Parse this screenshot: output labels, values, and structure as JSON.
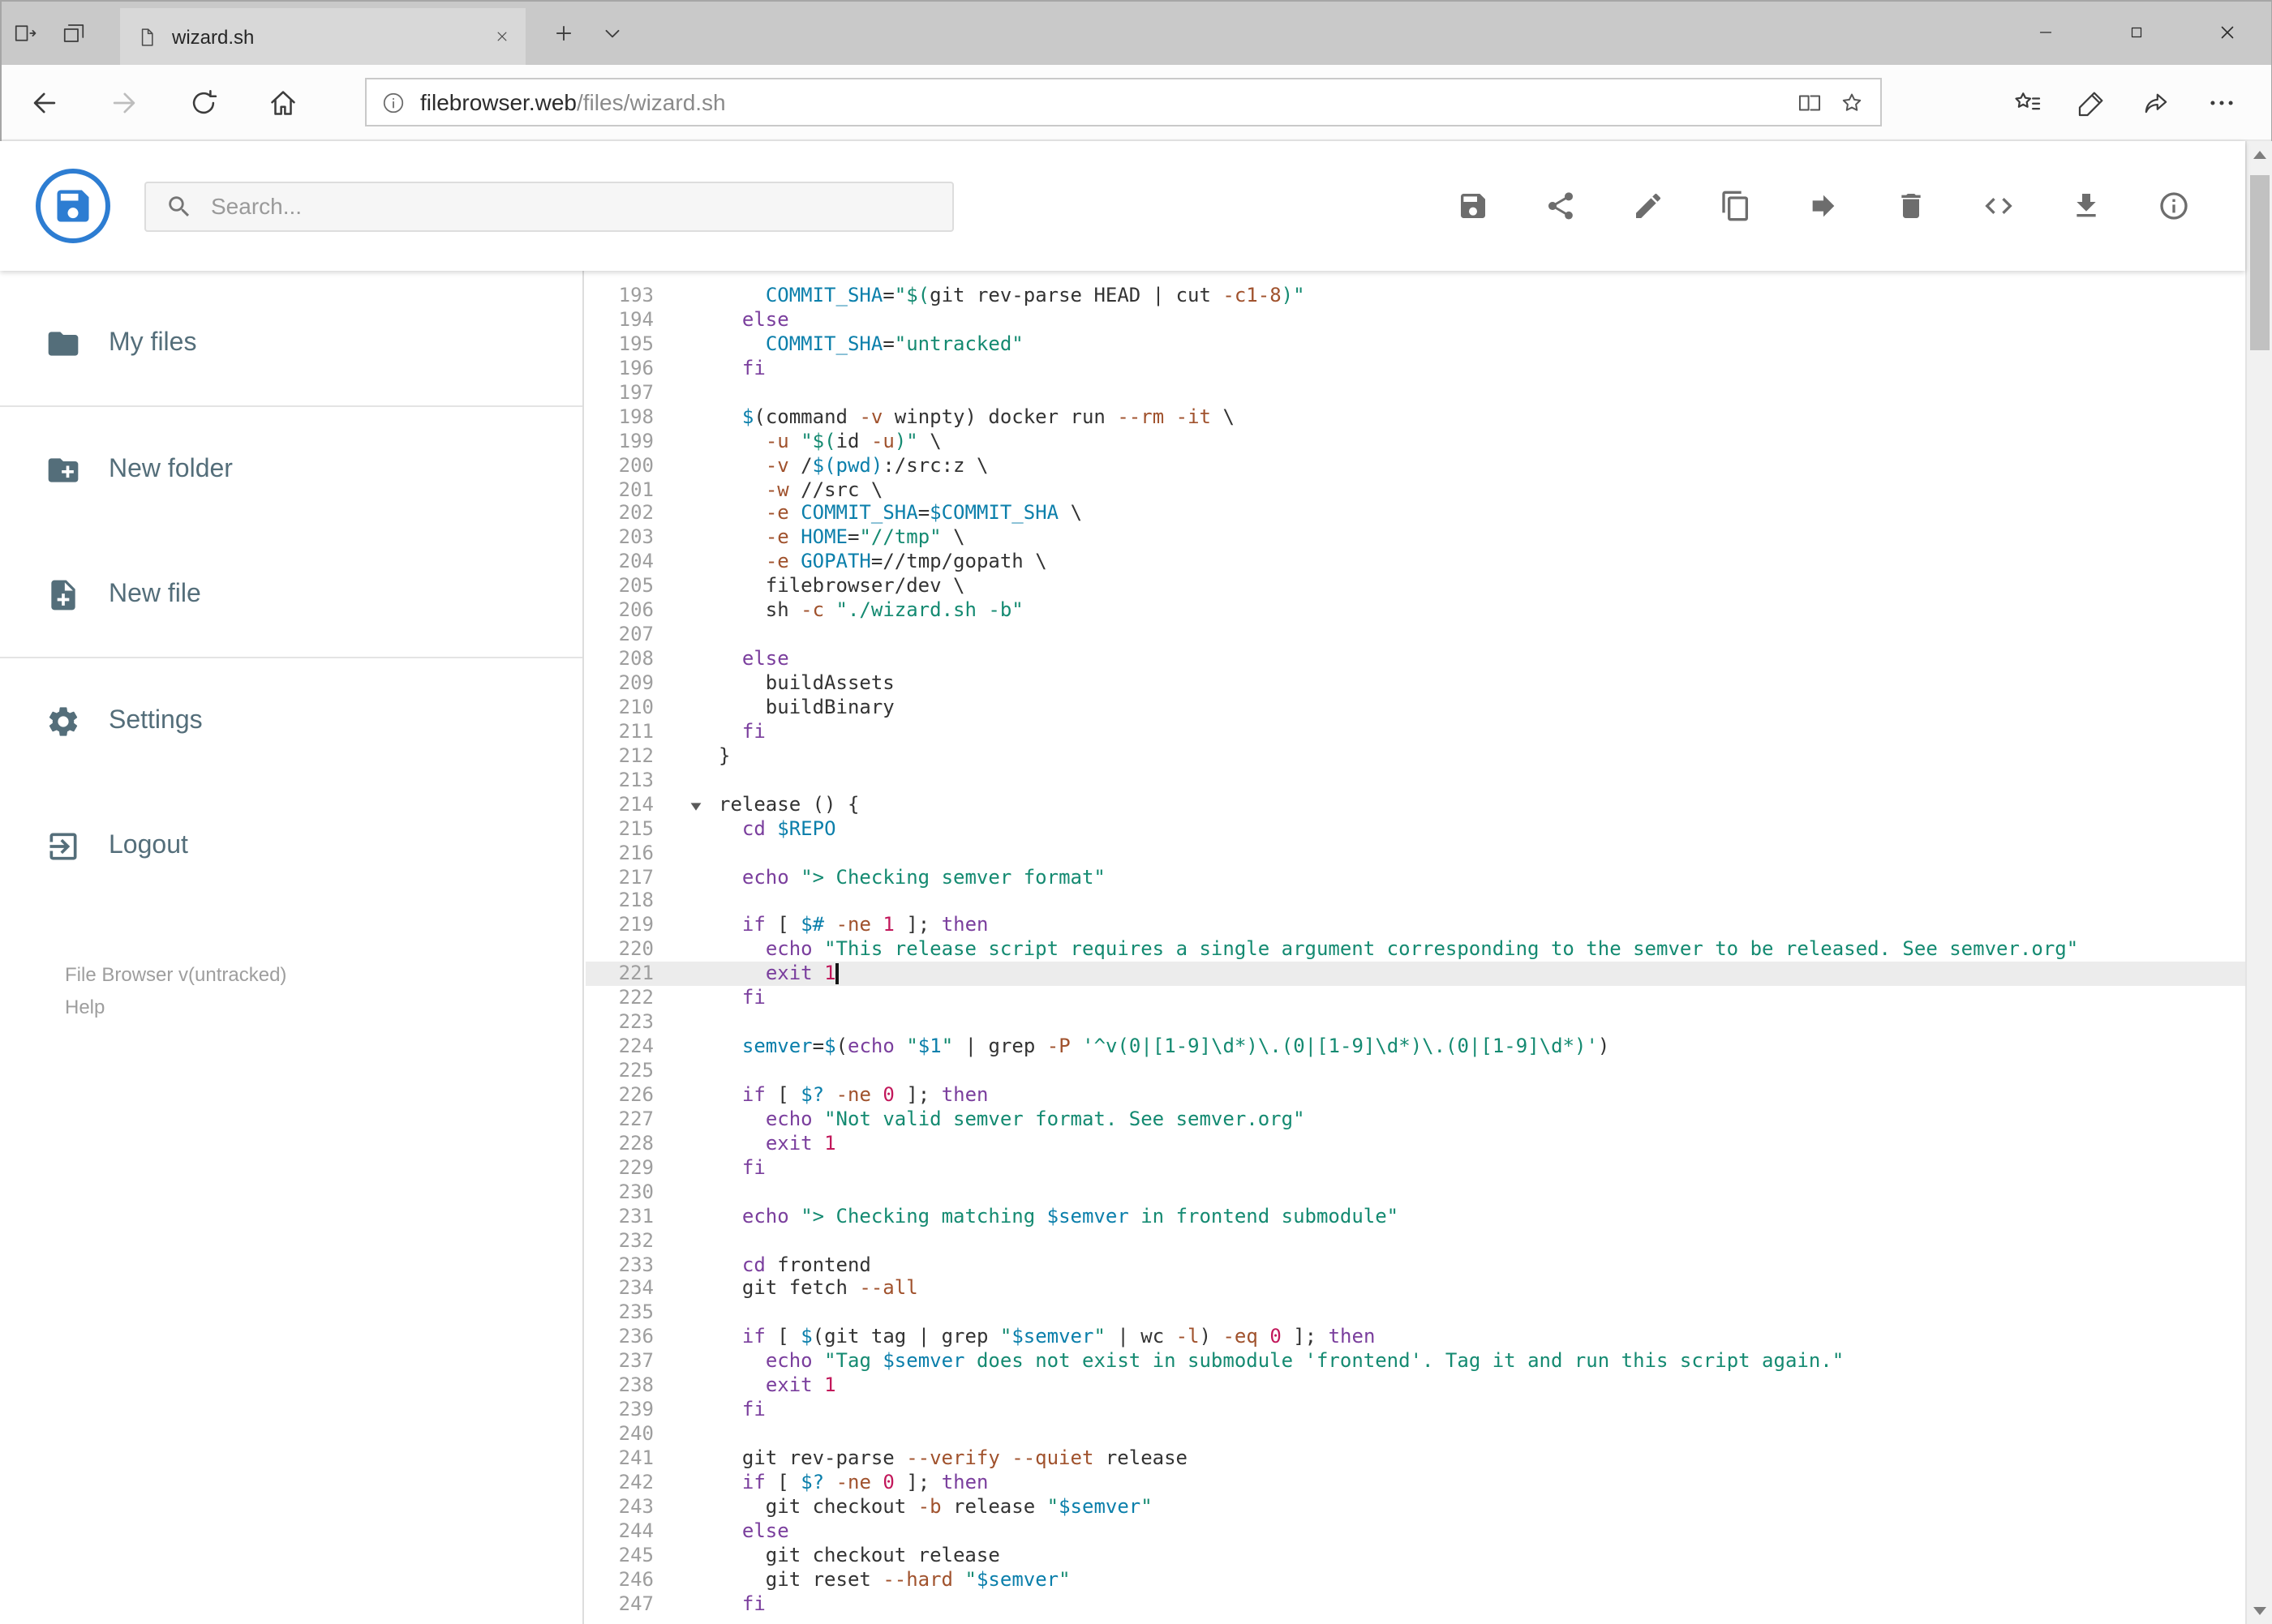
{
  "browser": {
    "tab_title": "wizard.sh",
    "url_host": "filebrowser.web",
    "url_path": "/files/wizard.sh",
    "nav_left": [
      {
        "name": "back",
        "icon": "back",
        "enabled": true
      },
      {
        "name": "forward",
        "icon": "forward",
        "enabled": false
      },
      {
        "name": "refresh",
        "icon": "refresh",
        "enabled": true
      },
      {
        "name": "home",
        "icon": "home",
        "enabled": true
      }
    ],
    "nav_right": [
      {
        "name": "favorites-hub",
        "icon": "hub"
      },
      {
        "name": "web-note",
        "icon": "pen"
      },
      {
        "name": "share-page",
        "icon": "share"
      },
      {
        "name": "more-options",
        "icon": "dots"
      }
    ]
  },
  "app": {
    "search_placeholder": "Search...",
    "toolbar": [
      {
        "name": "save",
        "icon": "save"
      },
      {
        "name": "share",
        "icon": "share-nodes"
      },
      {
        "name": "edit",
        "icon": "pencil"
      },
      {
        "name": "copy",
        "icon": "copy"
      },
      {
        "name": "move",
        "icon": "move"
      },
      {
        "name": "delete",
        "icon": "trash"
      },
      {
        "name": "view-source",
        "icon": "code"
      },
      {
        "name": "download",
        "icon": "download"
      },
      {
        "name": "info",
        "icon": "info"
      }
    ],
    "sidebar": {
      "items": [
        {
          "label": "My files",
          "icon": "folder",
          "divider_after": true
        },
        {
          "label": "New folder",
          "icon": "folder-plus",
          "divider_after": false
        },
        {
          "label": "New file",
          "icon": "file-plus",
          "divider_after": true
        },
        {
          "label": "Settings",
          "icon": "gear",
          "divider_after": false
        },
        {
          "label": "Logout",
          "icon": "logout",
          "divider_after": false
        }
      ],
      "footer_version": "File Browser v(untracked)",
      "footer_help": "Help"
    }
  },
  "editor": {
    "first_line": 193,
    "active_line": 221,
    "fold_lines": [
      214
    ],
    "cursor": {
      "line": 221,
      "col": 10
    },
    "lines": [
      "    COMMIT_SHA=\"$(git rev-parse HEAD | cut -c1-8)\"",
      "  else",
      "    COMMIT_SHA=\"untracked\"",
      "  fi",
      "",
      "  $(command -v winpty) docker run --rm -it \\",
      "    -u \"$(id -u)\" \\",
      "    -v /$(pwd):/src:z \\",
      "    -w //src \\",
      "    -e COMMIT_SHA=$COMMIT_SHA \\",
      "    -e HOME=\"//tmp\" \\",
      "    -e GOPATH=//tmp/gopath \\",
      "    filebrowser/dev \\",
      "    sh -c \"./wizard.sh -b\"",
      "",
      "  else",
      "    buildAssets",
      "    buildBinary",
      "  fi",
      "}",
      "",
      "release () {",
      "  cd $REPO",
      "",
      "  echo \"> Checking semver format\"",
      "",
      "  if [ $# -ne 1 ]; then",
      "    echo \"This release script requires a single argument corresponding to the semver to be released. See semver.org\"",
      "    exit 1",
      "  fi",
      "",
      "  semver=$(echo \"$1\" | grep -P '^v(0|[1-9]\\d*)\\.(0|[1-9]\\d*)\\.(0|[1-9]\\d*)')",
      "",
      "  if [ $? -ne 0 ]; then",
      "    echo \"Not valid semver format. See semver.org\"",
      "    exit 1",
      "  fi",
      "",
      "  echo \"> Checking matching $semver in frontend submodule\"",
      "",
      "  cd frontend",
      "  git fetch --all",
      "",
      "  if [ $(git tag | grep \"$semver\" | wc -l) -eq 0 ]; then",
      "    echo \"Tag $semver does not exist in submodule 'frontend'. Tag it and run this script again.\"",
      "    exit 1",
      "  fi",
      "",
      "  git rev-parse --verify --quiet release",
      "  if [ $? -ne 0 ]; then",
      "    git checkout -b release \"$semver\"",
      "  else",
      "    git checkout release",
      "    git reset --hard \"$semver\"",
      "  fi"
    ]
  },
  "colors": {
    "accent_blue": "#2d7dd2",
    "sidebar_text": "#546e7a",
    "toolbar_icon": "#6d6d6d",
    "syntax": {
      "keyword": "#7a3e9d",
      "string": "#148a71",
      "variable": "#0b7fab",
      "number": "#c2185b",
      "flag": "#a0522d",
      "text": "#333333",
      "line_number": "#9e9e9e",
      "active_line_bg": "#ececec"
    }
  }
}
